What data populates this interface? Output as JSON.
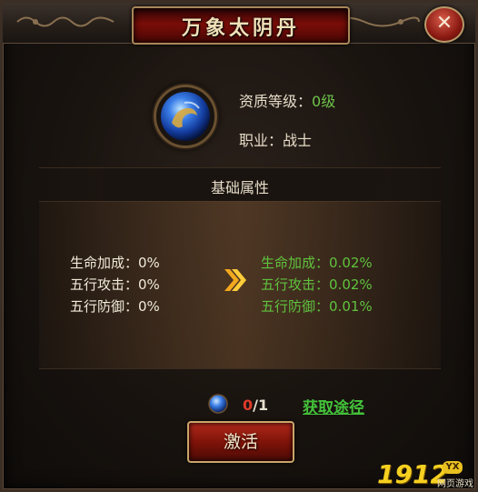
{
  "window": {
    "title": "万象太阴丹",
    "close_label": "✕"
  },
  "item": {
    "icon": "blue-orb-icon",
    "qualification_label": "资质等级：",
    "qualification_value": "0级",
    "profession_label": "职业：",
    "profession_value": "战士"
  },
  "section": {
    "title": "基础属性"
  },
  "attributes": {
    "current": [
      {
        "label": "生命加成：",
        "value": "0%"
      },
      {
        "label": "五行攻击：",
        "value": "0%"
      },
      {
        "label": "五行防御：",
        "value": "0%"
      }
    ],
    "next": [
      {
        "label": "生命加成：",
        "value": "0.02%"
      },
      {
        "label": "五行攻击：",
        "value": "0.02%"
      },
      {
        "label": "五行防御：",
        "value": "0.01%"
      }
    ]
  },
  "footer": {
    "have": "0",
    "need": "/1",
    "obtain_link": "获取途径",
    "activate_label": "激活"
  },
  "watermark": {
    "number": "1912",
    "badge": "YX",
    "sub": "网页游戏"
  },
  "colors": {
    "accent_green": "#5fc23e",
    "accent_red": "#e03a2a",
    "button_red": "#7a1208",
    "gold_border": "#c9a56a"
  }
}
